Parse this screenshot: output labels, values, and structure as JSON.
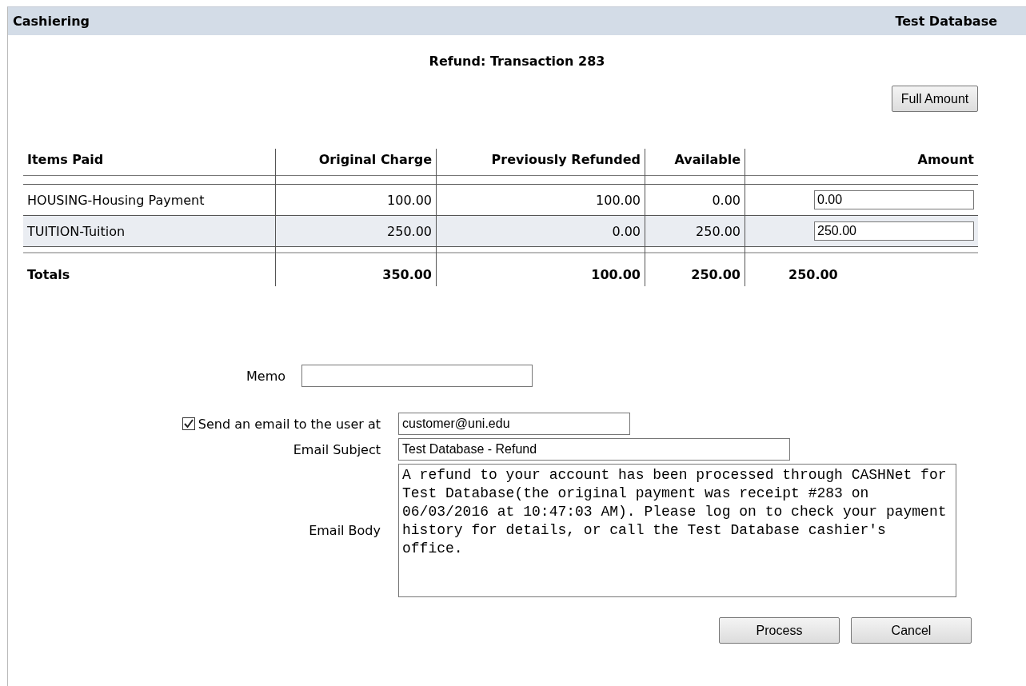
{
  "header": {
    "title": "Cashiering",
    "database": "Test Database"
  },
  "page_title": "Refund: Transaction 283",
  "full_amount_button": "Full Amount",
  "table": {
    "columns": [
      "Items Paid",
      "Original Charge",
      "Previously Refunded",
      "Available",
      "Amount"
    ],
    "rows": [
      {
        "item": "HOUSING-Housing Payment",
        "original_charge": "100.00",
        "previously_refunded": "100.00",
        "available": "0.00",
        "amount": "0.00"
      },
      {
        "item": "TUITION-Tuition",
        "original_charge": "250.00",
        "previously_refunded": "0.00",
        "available": "250.00",
        "amount": "250.00"
      }
    ],
    "totals": {
      "label": "Totals",
      "original_charge": "350.00",
      "previously_refunded": "100.00",
      "available": "250.00",
      "amount": "250.00"
    }
  },
  "memo": {
    "label": "Memo"
  },
  "send_email": {
    "label": "Send an email to the user at",
    "checked": true,
    "value": "customer@uni.edu"
  },
  "email_subject": {
    "label": "Email Subject",
    "value": "Test Database - Refund"
  },
  "email_body": {
    "label": "Email Body",
    "value": "A refund to your account has been processed through CASHNet for Test Database(the original payment was receipt #283 on 06/03/2016 at 10:47:03 AM). Please log on to check your payment history for details, or call the Test Database cashier's office."
  },
  "buttons": [
    "Process",
    "Cancel"
  ]
}
